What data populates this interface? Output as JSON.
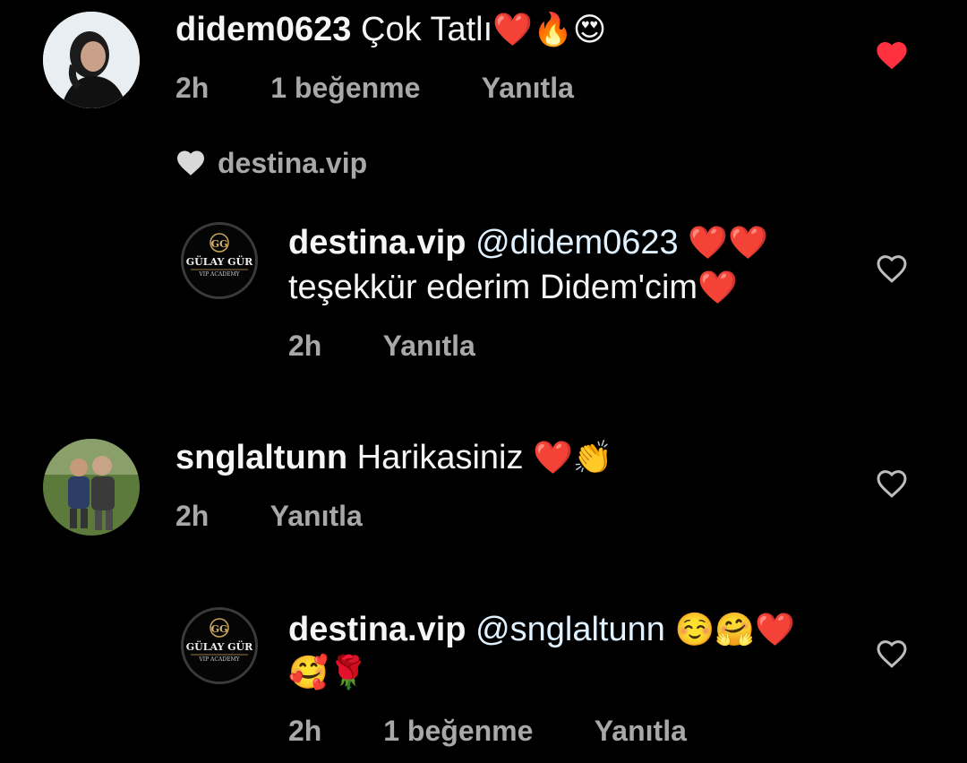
{
  "comments": [
    {
      "username": "didem0623",
      "text": "Çok Tatlı",
      "emojis": "❤️🔥😍",
      "time": "2h",
      "likes": "1 beğenme",
      "reply": "Yanıtla",
      "liked": true
    },
    {
      "username": "snglаltunn",
      "text": "Harikasiniz",
      "emojis": "❤️👏",
      "time": "2h",
      "reply": "Yanıtla",
      "liked": false
    }
  ],
  "creator_like": {
    "label": "destina.vip"
  },
  "replies": [
    {
      "username": "destina.vip",
      "mention": "@didem0623",
      "emojis_line1": "❤️❤️",
      "text_line2": "teşekkür ederim Didem'cim",
      "emojis_line2": "❤️",
      "time": "2h",
      "reply": "Yanıtla",
      "liked": false
    },
    {
      "username": "destina.vip",
      "mention": "@snglaltunn",
      "emojis_line1": "☺️🤗❤️",
      "emojis_line2": "🥰🌹",
      "time": "2h",
      "likes": "1 beğenme",
      "reply": "Yanıtla",
      "liked": false
    }
  ],
  "logo": {
    "monogram": "GG",
    "name": "GÜLAY GÜR",
    "sub": "VIP ACADEMY"
  },
  "colors": {
    "background": "#000000",
    "meta": "#a8a8a8",
    "like_red": "#ff3040",
    "mention": "#e0f1ff"
  }
}
